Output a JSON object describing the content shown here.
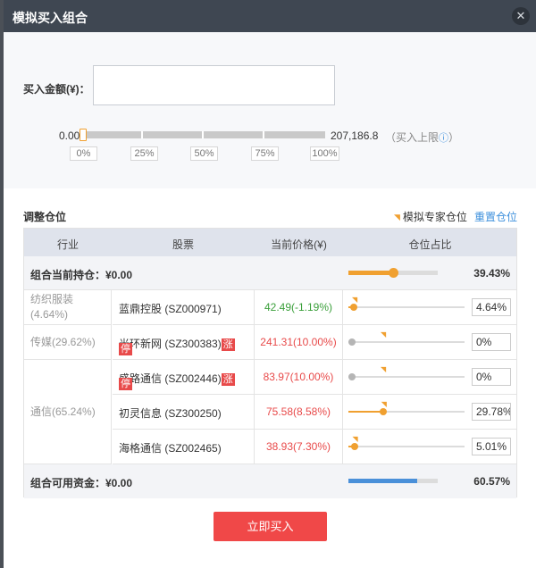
{
  "dialog": {
    "title": "模拟买入组合",
    "close_icon": "close-icon"
  },
  "buy": {
    "amount_label": "买入金额(¥)：",
    "amount_value": "",
    "slider_min": "0.00",
    "slider_max": "207,186.8",
    "slider_max_hint": "（买入上限",
    "slider_max_hint_end": "）",
    "slider_value_fraction": 0,
    "pct_buttons": [
      "0%",
      "25%",
      "50%",
      "75%",
      "100%"
    ]
  },
  "adjust": {
    "title": "调整仓位",
    "expert_link": "模拟专家仓位",
    "reset_link": "重置仓位"
  },
  "table": {
    "headers": [
      "行业",
      "股票",
      "当前价格(¥)",
      "仓位占比"
    ],
    "holding_summary": {
      "label": "组合当前持仓：¥0.00",
      "pct": "39.43%",
      "fraction": 0.3943
    },
    "cash_summary": {
      "label": "组合可用资金：¥0.00",
      "pct": "60.57%",
      "fraction": 0.6057
    },
    "industries": [
      {
        "label": "纺织服装",
        "sub": "(4.64%)"
      },
      {
        "label": "传媒(29.62%)",
        "sub": ""
      },
      {
        "label": "通信(65.24%)",
        "sub": ""
      }
    ],
    "stocks": [
      {
        "name": "蓝鼎控股 (SZ000971)",
        "badge": "",
        "price": "42.49(-1.19%)",
        "trend": "down",
        "weight": "4.64%",
        "fraction": 0.0464
      },
      {
        "name": "光环新网 (SZ300383)",
        "badge": "涨停",
        "price": "241.31(10.00%)",
        "trend": "up",
        "weight": "0%",
        "fraction": 0
      },
      {
        "name": "盛路通信 (SZ002446)",
        "badge": "涨停",
        "price": "83.97(10.00%)",
        "trend": "up",
        "weight": "0%",
        "fraction": 0
      },
      {
        "name": "初灵信息 (SZ300250)",
        "badge": "",
        "price": "75.58(8.58%)",
        "trend": "up",
        "weight": "29.78%",
        "fraction": 0.2978
      },
      {
        "name": "海格通信 (SZ002465)",
        "badge": "",
        "price": "38.93(7.30%)",
        "trend": "up",
        "weight": "5.01%",
        "fraction": 0.0501
      }
    ]
  },
  "actions": {
    "buy_now": "立即买入"
  },
  "colors": {
    "accent": "#f0a030",
    "primary": "#f04848",
    "link": "#3c8fdc",
    "cash_bar": "#4a90d9"
  }
}
